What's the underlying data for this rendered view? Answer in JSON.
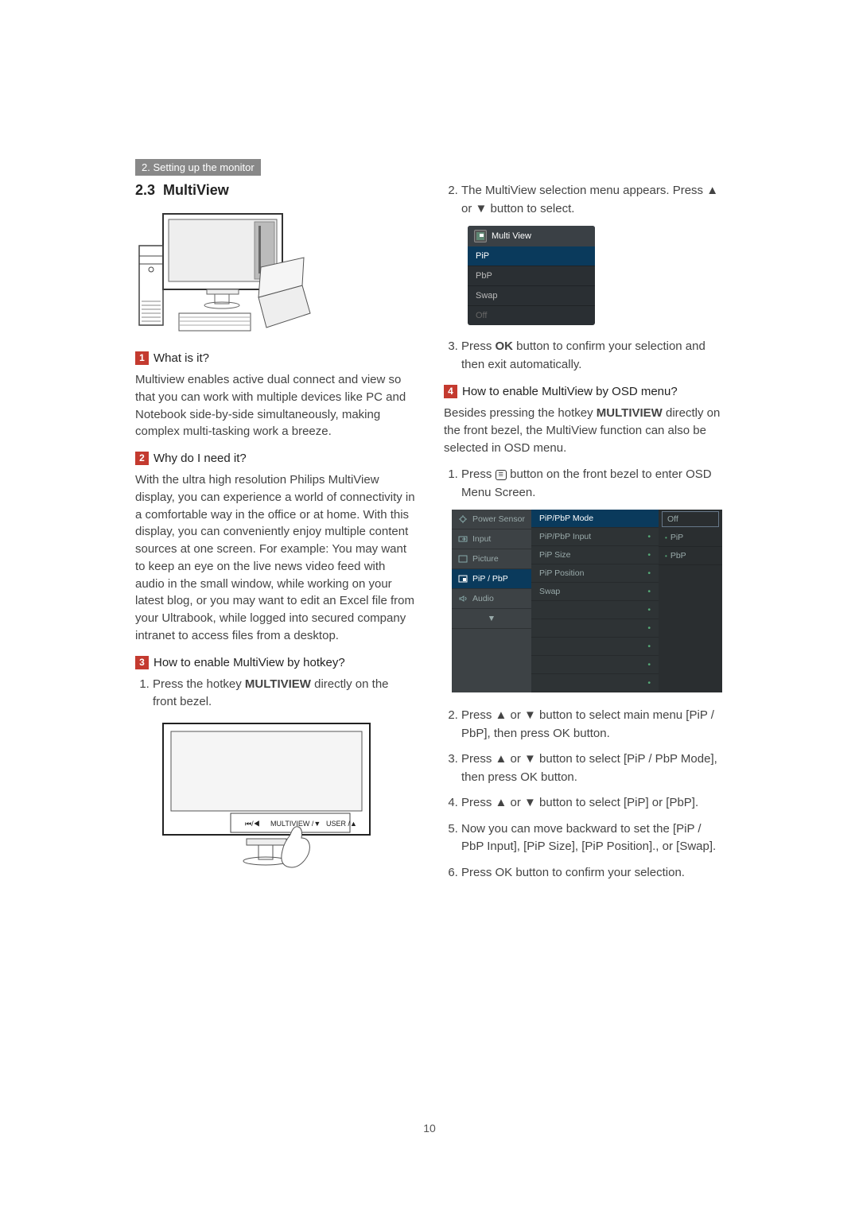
{
  "chapter_header": "2. Setting up the monitor",
  "section_number": "2.3",
  "section_title": "MultiView",
  "q1": {
    "num": "1",
    "title": "What is it?",
    "body": "Multiview enables active dual connect and view so that you can work with multiple devices like PC and Notebook side-by-side simultaneously, making complex multi-tasking work a breeze."
  },
  "q2": {
    "num": "2",
    "title": "Why do I need it?",
    "body": "With the ultra high resolution Philips MultiView display, you can experience a world of connectivity in a comfortable way in the office or at home. With this display, you can conveniently enjoy multiple content sources at one screen. For example: You may want to keep an eye on the live news video feed with audio in the small window, while working on your latest blog, or you may want to edit an Excel file from your Ultrabook, while logged into secured company intranet to access files from a desktop."
  },
  "q3": {
    "num": "3",
    "title": "How to enable MultiView by hotkey?",
    "step1_a": "Press the hotkey ",
    "step1_key": "MULTIVIEW",
    "step1_b": " directly on the front bezel."
  },
  "bezel_labels": {
    "left": "⏮/◀",
    "mid": "MULTIVIEW /▼",
    "right": "USER /▲"
  },
  "r_step2_a": "The MultiView selection menu appears. Press ▲ or ▼ button to select.",
  "osd_mv": {
    "header": "Multi View",
    "items": [
      "PiP",
      "PbP",
      "Swap",
      "Off"
    ]
  },
  "r_step3_a": "Press ",
  "r_step3_key": "OK",
  "r_step3_b": " button to confirm your selection and then exit automatically.",
  "q4": {
    "num": "4",
    "title": "How to enable MultiView by OSD menu?",
    "intro_a": "Besides pressing the hotkey ",
    "intro_key": "MULTIVIEW",
    "intro_b": " directly on the front bezel,  the MultiView function can also be selected in OSD menu."
  },
  "q4_step1_a": "Press ",
  "q4_step1_b": " button on the front bezel to enter OSD Menu Screen.",
  "osd_main": {
    "left": [
      "Power Sensor",
      "Input",
      "Picture",
      "PiP / PbP",
      "Audio",
      "▼"
    ],
    "left_active_index": 3,
    "mid": [
      "PiP/PbP Mode",
      "PiP/PbP Input",
      "PiP Size",
      "PiP Position",
      "Swap"
    ],
    "right": [
      "Off",
      "PiP",
      "PbP"
    ]
  },
  "q4_step2": "Press ▲ or ▼ button to select main menu [PiP / PbP], then press OK button.",
  "q4_step3": "Press ▲ or ▼ button to select [PiP / PbP Mode], then press OK button.",
  "q4_step4": "Press ▲ or ▼ button to select [PiP] or [PbP].",
  "q4_step5": "Now you can move backward to set the [PiP / PbP Input], [PiP Size], [PiP Position]., or [Swap].",
  "q4_step6": "Press OK button to confirm your selection.",
  "page_number": "10"
}
